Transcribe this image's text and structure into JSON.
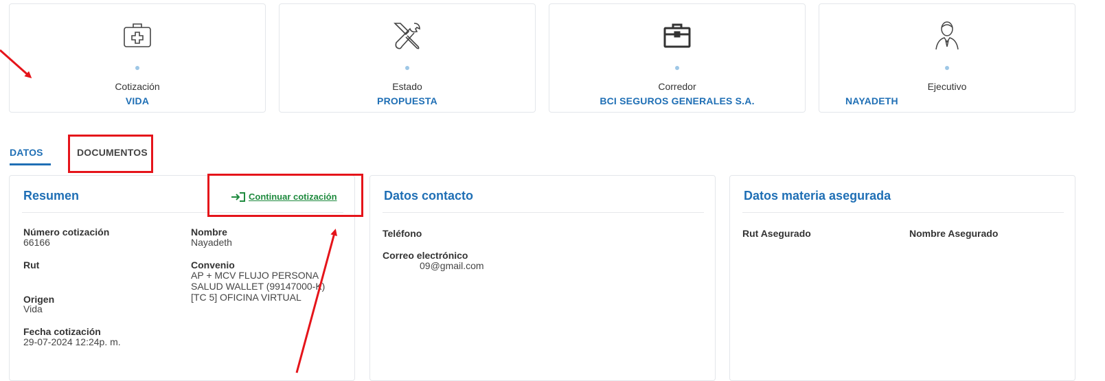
{
  "cards": [
    {
      "label": "Cotización",
      "value": "VIDA",
      "icon": "medical-kit-icon"
    },
    {
      "label": "Estado",
      "value": "PROPUESTA",
      "icon": "tools-icon"
    },
    {
      "label": "Corredor",
      "value": "BCI SEGUROS GENERALES S.A.",
      "icon": "briefcase-icon"
    },
    {
      "label": "Ejecutivo",
      "value": "NAYADETH",
      "icon": "person-icon"
    }
  ],
  "tabs": {
    "datos": "DATOS",
    "documentos": "DOCUMENTOS"
  },
  "resumen": {
    "title": "Resumen",
    "continue_link": "Continuar cotización",
    "numero_label": "Número cotización",
    "numero_value": "66166",
    "nombre_label": "Nombre",
    "nombre_value": "Nayadeth",
    "rut_label": "Rut",
    "convenio_label": "Convenio",
    "convenio_lines": [
      "AP + MCV FLUJO PERSONA",
      "SALUD WALLET (99147000-K)",
      "[TC 5] OFICINA VIRTUAL"
    ],
    "origen_label": "Origen",
    "origen_value": "Vida",
    "fecha_label": "Fecha cotización",
    "fecha_value": "29-07-2024 12:24p. m."
  },
  "contacto": {
    "title": "Datos contacto",
    "telefono_label": "Teléfono",
    "correo_label": "Correo electrónico",
    "correo_value": "09@gmail.com"
  },
  "materia": {
    "title": "Datos materia asegurada",
    "rut_label": "Rut Asegurado",
    "nombre_label": "Nombre Asegurado"
  },
  "colors": {
    "accent": "#1f6fb5",
    "link_green": "#1e8a3e",
    "annotation_red": "#e5141a"
  }
}
